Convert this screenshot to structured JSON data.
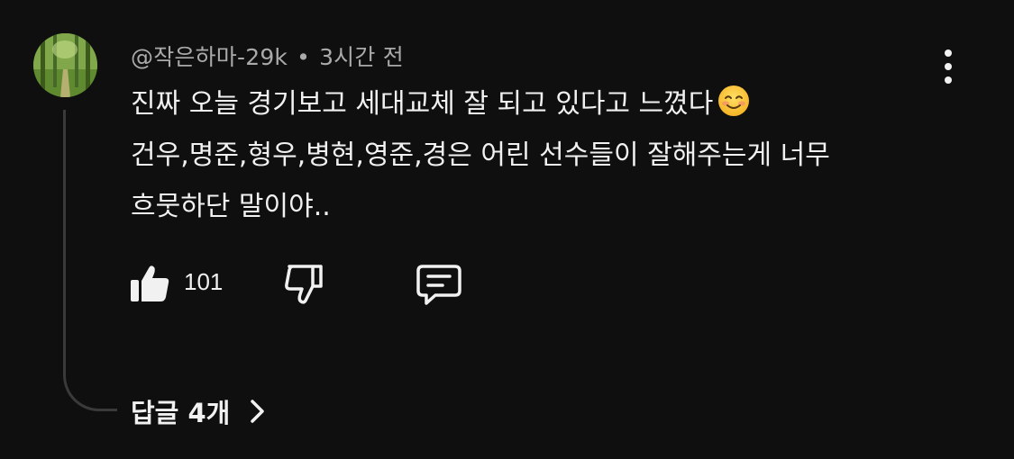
{
  "comment": {
    "author": "@작은하마-29k",
    "separator": "•",
    "timestamp": "3시간 전",
    "text_lines": [
      "진짜 오늘 경기보고 세대교체 잘 되고 있다고 느꼈다",
      "건우,명준,형우,병현,영준,경은 어린 선수들이 잘해주는게 너무",
      "흐뭇하단 말이야.."
    ],
    "emoji": "smiling-face-emoji",
    "like_count": "101",
    "replies_label": "답글 4개"
  },
  "icons": {
    "like": "thumbs-up-icon",
    "dislike": "thumbs-down-icon",
    "reply": "comment-bubble-icon",
    "more": "more-vertical-icon",
    "chevron": "chevron-right-icon"
  },
  "colors": {
    "background": "#0f0f0f",
    "primary_text": "#f1f1f1",
    "secondary_text": "#aaaaaa",
    "thread_line": "#3a3a3a"
  }
}
